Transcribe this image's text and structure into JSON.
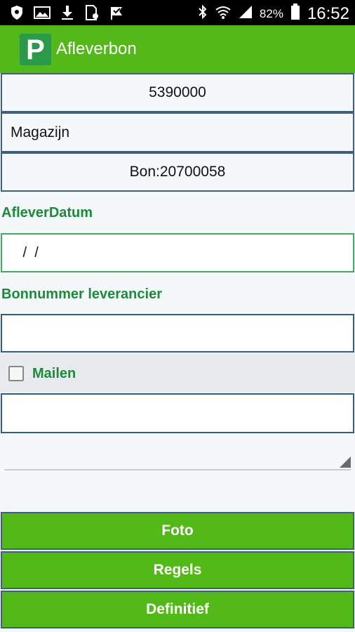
{
  "status_bar": {
    "battery_percent": "82%",
    "time": "16:52",
    "icons": [
      "shield-icon",
      "image-icon",
      "download-icon",
      "sim-icon",
      "check-flag-icon",
      "bluetooth-icon",
      "wifi-icon",
      "signal-icon",
      "battery-icon"
    ]
  },
  "app_bar": {
    "logo_letter": "P",
    "title": "Afleverbon"
  },
  "form": {
    "number_value": "5390000",
    "location_value": "Magazijn",
    "bon_value": "Bon:20700058",
    "delivery_date_label": "AfleverDatum",
    "delivery_date_value": " /  /",
    "supplier_bon_label": "Bonnummer leverancier",
    "supplier_bon_value": "",
    "mail_label": "Mailen",
    "mail_checked": false,
    "mail_value": ""
  },
  "buttons": {
    "foto": "Foto",
    "regels": "Regels",
    "definitief": "Definitief"
  },
  "colors": {
    "accent_green": "#52b918",
    "label_green": "#1d8a3a",
    "border_blue": "#3f5f7f"
  }
}
